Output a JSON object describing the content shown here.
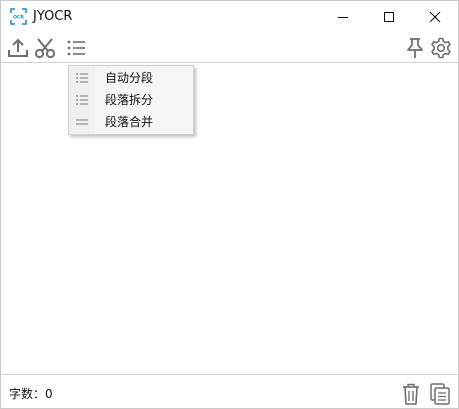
{
  "window": {
    "title": "JYOCR",
    "app_icon_text": "OCR"
  },
  "toolbar": {
    "icons": [
      "upload-icon",
      "scissors-icon",
      "list-icon",
      "pin-icon",
      "gear-icon"
    ]
  },
  "menu": {
    "items": [
      {
        "label": "自动分段",
        "icon": "list-icon"
      },
      {
        "label": "段落拆分",
        "icon": "list-icon"
      },
      {
        "label": "段落合并",
        "icon": "merge-lines-icon"
      }
    ]
  },
  "editor": {
    "text": ""
  },
  "status": {
    "word_count_label": "字数：",
    "word_count_value": "0",
    "icons": [
      "trash-icon",
      "copy-icon"
    ]
  },
  "colors": {
    "icon": "#6e6e6e",
    "accent": "#1a86c8"
  }
}
